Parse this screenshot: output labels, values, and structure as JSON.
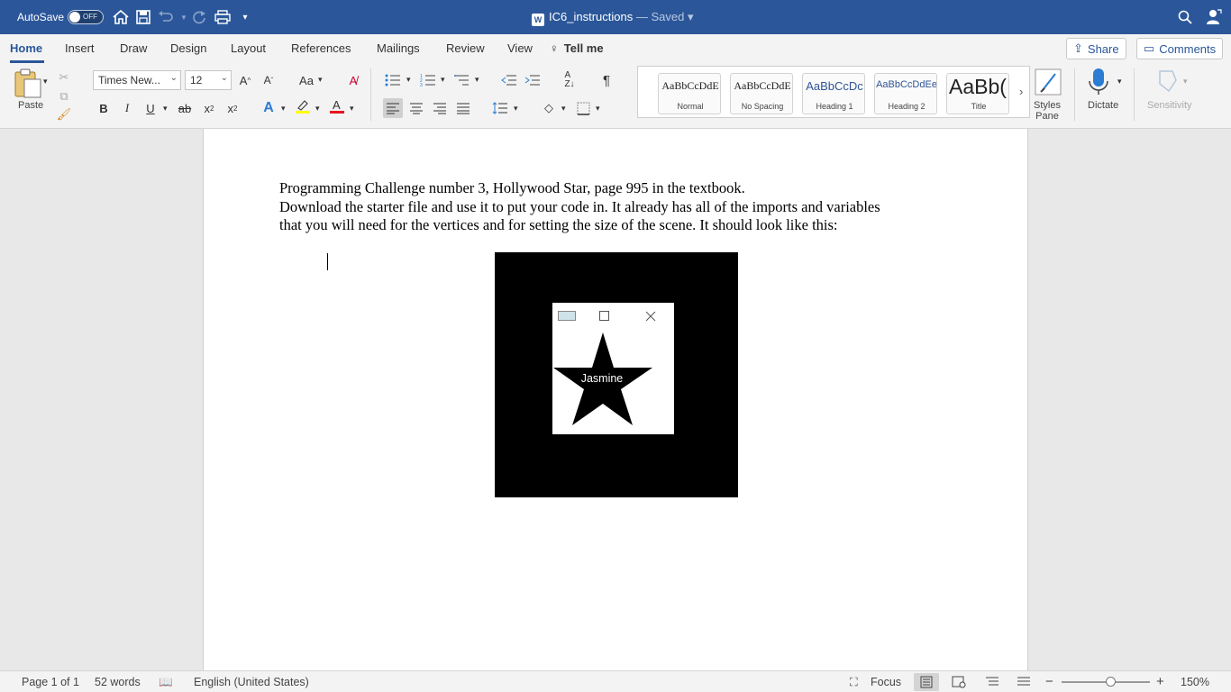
{
  "titlebar": {
    "autosave_label": "AutoSave",
    "autosave_state": "OFF",
    "doc_name": "IC6_instructions",
    "doc_status": "— Saved"
  },
  "ribbon_tabs": [
    "Home",
    "Insert",
    "Draw",
    "Design",
    "Layout",
    "References",
    "Mailings",
    "Review",
    "View"
  ],
  "tell_me": "Tell me",
  "share_label": "Share",
  "comments_label": "Comments",
  "clipboard": {
    "paste_label": "Paste"
  },
  "font": {
    "name": "Times New...",
    "size": "12"
  },
  "styles": [
    {
      "sample": "AaBbCcDdE",
      "name": "Normal"
    },
    {
      "sample": "AaBbCcDdE",
      "name": "No Spacing"
    },
    {
      "sample": "AaBbCcDc",
      "name": "Heading 1"
    },
    {
      "sample": "AaBbCcDdEe",
      "name": "Heading 2"
    },
    {
      "sample": "AaBb(",
      "name": "Title"
    }
  ],
  "styles_pane_label": [
    "Styles",
    "Pane"
  ],
  "dictate_label": "Dictate",
  "sensitivity_label": "Sensitivity",
  "document": {
    "line1": "Programming Challenge number 3, Hollywood Star, page 995 in the textbook.",
    "line2": "Download the starter file and use it to put your code in. It already has all of the imports and variables",
    "line3": "that you will need for the vertices and for setting the size of the scene.  It should look like this:",
    "figure_label": "Jasmine"
  },
  "statusbar": {
    "page": "Page 1 of 1",
    "words": "52 words",
    "language": "English (United States)",
    "focus": "Focus",
    "zoom": "150%"
  },
  "colors": {
    "titlebar": "#2b579a",
    "accent": "#2b579a",
    "highlight": "#ffff00",
    "font_color": "#e81123"
  }
}
